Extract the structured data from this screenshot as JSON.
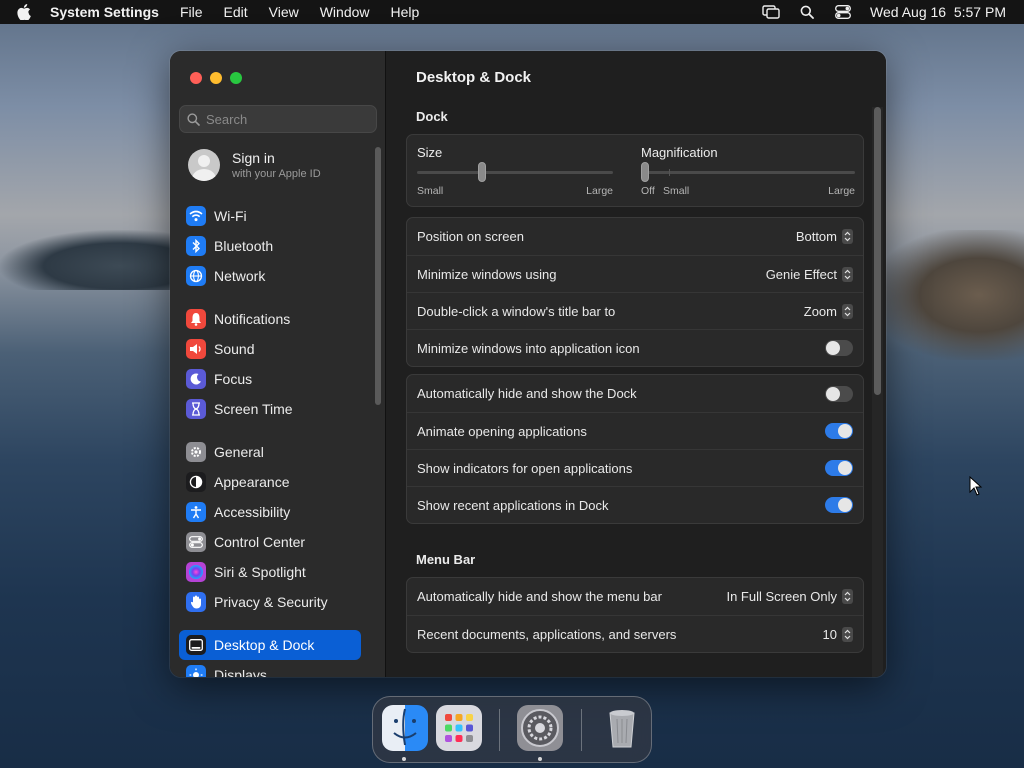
{
  "menubar": {
    "app_name": "System Settings",
    "menus": [
      "File",
      "Edit",
      "View",
      "Window",
      "Help"
    ],
    "clock": "Wed Aug 16  5:57 PM"
  },
  "sidebar": {
    "search_placeholder": "Search",
    "account": {
      "title": "Sign in",
      "subtitle": "with your Apple ID"
    },
    "items": [
      {
        "label": "Wi-Fi",
        "icon": "wifi-icon",
        "color": "#1f7cf5"
      },
      {
        "label": "Bluetooth",
        "icon": "bluetooth-icon",
        "color": "#1f7cf5"
      },
      {
        "label": "Network",
        "icon": "globe-icon",
        "color": "#1f7cf5"
      },
      {
        "label": "Notifications",
        "icon": "bell-icon",
        "color": "#f0483c"
      },
      {
        "label": "Sound",
        "icon": "speaker-icon",
        "color": "#f0483c"
      },
      {
        "label": "Focus",
        "icon": "moon-icon",
        "color": "#5b5ad6"
      },
      {
        "label": "Screen Time",
        "icon": "hourglass-icon",
        "color": "#5b5ad6"
      },
      {
        "label": "General",
        "icon": "gear-icon",
        "color": "#8e8e93"
      },
      {
        "label": "Appearance",
        "icon": "appearance-icon",
        "color": "#1c1c1e"
      },
      {
        "label": "Accessibility",
        "icon": "accessibility-icon",
        "color": "#1f7cf5"
      },
      {
        "label": "Control Center",
        "icon": "control-center-icon",
        "color": "#8e8e93"
      },
      {
        "label": "Siri & Spotlight",
        "icon": "siri-icon",
        "color": "#b543d6"
      },
      {
        "label": "Privacy & Security",
        "icon": "hand-icon",
        "color": "#2f6ff0"
      },
      {
        "label": "Desktop & Dock",
        "icon": "dock-icon",
        "color": "#1c1c1e",
        "selected": true
      },
      {
        "label": "Displays",
        "icon": "sun-icon",
        "color": "#1f7cf5"
      }
    ]
  },
  "main": {
    "title": "Desktop & Dock",
    "dock_heading": "Dock",
    "size": {
      "title": "Size",
      "min_label": "Small",
      "max_label": "Large",
      "value": 0.33
    },
    "magnification": {
      "title": "Magnification",
      "off_label": "Off",
      "min_label": "Small",
      "max_label": "Large",
      "value": 0.0
    },
    "group1": [
      {
        "label": "Position on screen",
        "value": "Bottom"
      },
      {
        "label": "Minimize windows using",
        "value": "Genie Effect"
      },
      {
        "label": "Double-click a window's title bar to",
        "value": "Zoom"
      },
      {
        "label": "Minimize windows into application icon",
        "toggle": false
      }
    ],
    "group2": [
      {
        "label": "Automatically hide and show the Dock",
        "toggle": false
      },
      {
        "label": "Animate opening applications",
        "toggle": true
      },
      {
        "label": "Show indicators for open applications",
        "toggle": true
      },
      {
        "label": "Show recent applications in Dock",
        "toggle": true
      }
    ],
    "menubar_heading": "Menu Bar",
    "group3": [
      {
        "label": "Automatically hide and show the menu bar",
        "value": "In Full Screen Only"
      },
      {
        "label": "Recent documents, applications, and servers",
        "value": "10"
      }
    ]
  },
  "dock": {
    "apps": [
      {
        "name": "finder-icon",
        "running": true
      },
      {
        "name": "launchpad-icon",
        "running": false
      },
      {
        "name": "system-settings-icon",
        "running": true
      },
      {
        "name": "trash-icon",
        "running": false
      }
    ]
  }
}
